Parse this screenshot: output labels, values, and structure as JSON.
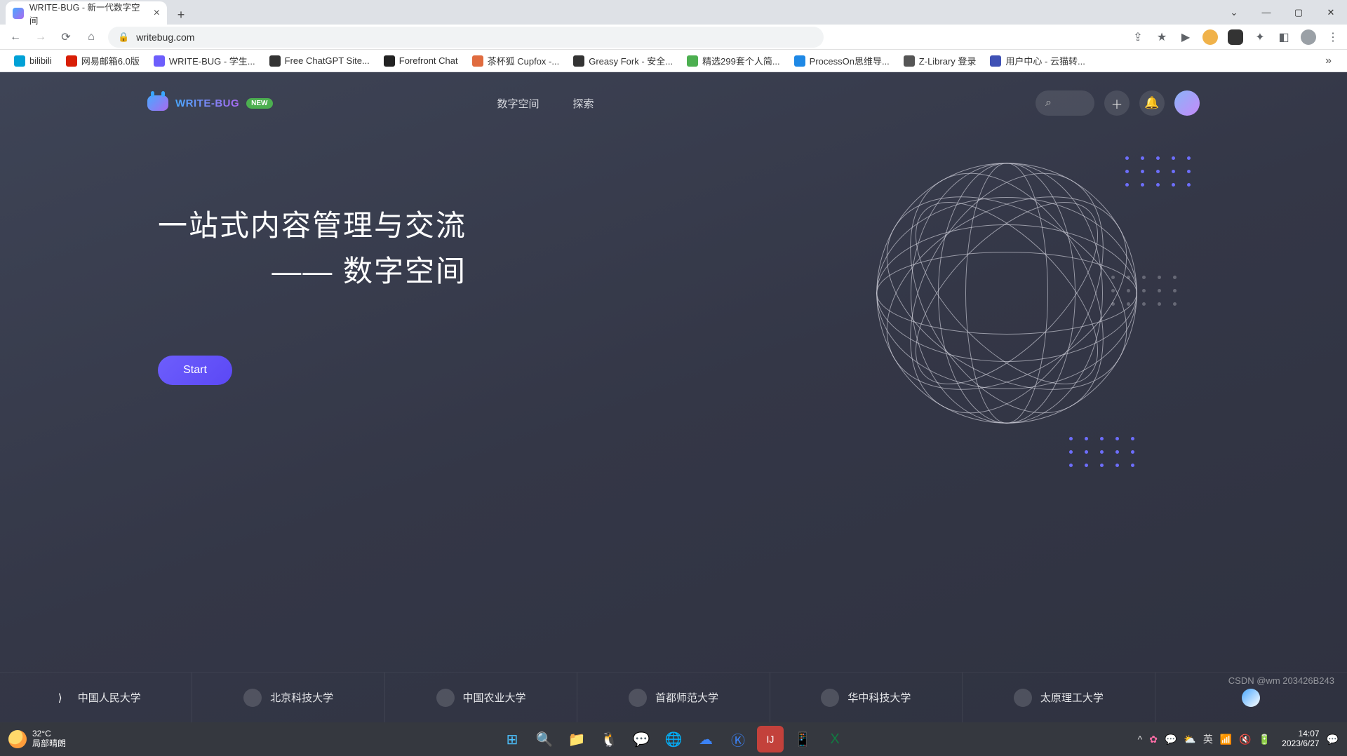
{
  "browser": {
    "tab_title": "WRITE-BUG - 新一代数字空间",
    "url": "writebug.com",
    "bookmarks": [
      {
        "label": "bilibili",
        "color": "#00a1d6"
      },
      {
        "label": "网易邮箱6.0版",
        "color": "#d81e06"
      },
      {
        "label": "WRITE-BUG - 学生...",
        "color": "#6d5efc"
      },
      {
        "label": "Free ChatGPT Site...",
        "color": "#333"
      },
      {
        "label": "Forefront Chat",
        "color": "#222"
      },
      {
        "label": "茶杯狐 Cupfox -...",
        "color": "#e06b3f"
      },
      {
        "label": "Greasy Fork - 安全...",
        "color": "#333"
      },
      {
        "label": "精选299套个人简...",
        "color": "#4caf50"
      },
      {
        "label": "ProcessOn思维导...",
        "color": "#1e88e5"
      },
      {
        "label": "Z-Library 登录",
        "color": "#555"
      },
      {
        "label": "用户中心 - 云猫转...",
        "color": "#3f51b5"
      }
    ]
  },
  "site": {
    "brand": "WRITE-BUG",
    "badge": "NEW",
    "nav": {
      "digital_space": "数字空间",
      "explore": "探索"
    },
    "hero_line1": "一站式内容管理与交流",
    "hero_line2": "—— 数字空间",
    "start": "Start",
    "universities": [
      "中国人民大学",
      "北京科技大学",
      "中国农业大学",
      "首都师范大学",
      "华中科技大学",
      "太原理工大学"
    ]
  },
  "taskbar": {
    "temp": "32°C",
    "weather": "局部晴朗",
    "ime": "英",
    "time": "14:07",
    "date": "2023/6/27"
  },
  "watermark": "CSDN @wm 203426B243"
}
